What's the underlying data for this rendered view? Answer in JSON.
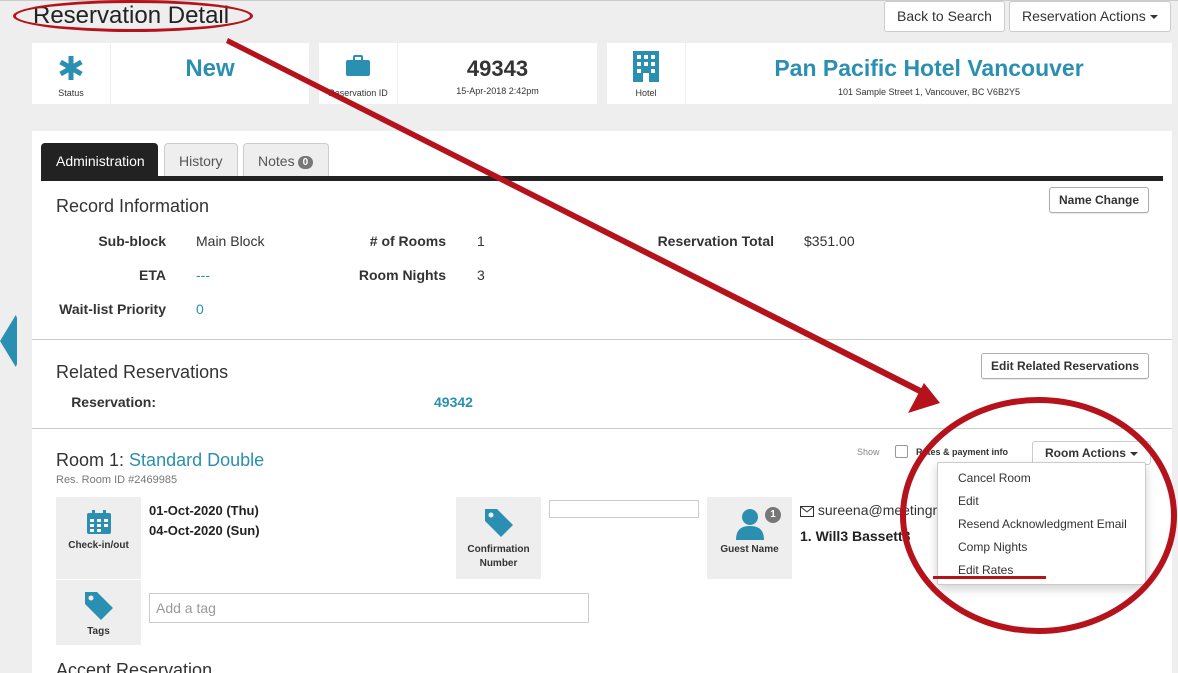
{
  "header": {
    "title": "Reservation Detail",
    "back_label": "Back to Search",
    "actions_label": "Reservation Actions"
  },
  "status_card": {
    "value": "New",
    "label": "Status",
    "icon": "asterisk-icon"
  },
  "reservation_card": {
    "value": "49343",
    "sub": "15-Apr-2018 2:42pm",
    "label": "Reservation ID",
    "icon": "briefcase-icon"
  },
  "hotel_card": {
    "name": "Pan Pacific Hotel Vancouver",
    "address": "101 Sample Street 1, Vancouver, BC V6B2Y5",
    "label": "Hotel",
    "icon": "building-icon"
  },
  "tabs": [
    {
      "label": "Administration",
      "active": true
    },
    {
      "label": "History",
      "active": false
    },
    {
      "label": "Notes",
      "badge": "0",
      "active": false
    }
  ],
  "record": {
    "title": "Record Information",
    "name_change_label": "Name Change",
    "subblock_label": "Sub-block",
    "subblock_value": "Main Block",
    "eta_label": "ETA",
    "eta_value": "---",
    "waitlist_label": "Wait-list Priority",
    "waitlist_value": "0",
    "rooms_label": "# of Rooms",
    "rooms_value": "1",
    "nights_label": "Room Nights",
    "nights_value": "3",
    "total_label": "Reservation Total",
    "total_value": "$351.00"
  },
  "related": {
    "title": "Related Reservations",
    "edit_label": "Edit Related Reservations",
    "reservation_label": "Reservation:",
    "reservation_value": "49342"
  },
  "room": {
    "title_prefix": "Room 1:",
    "room_type": "Standard Double",
    "room_id": "Res. Room ID #2469985",
    "show_label": "Show",
    "rates_label": "Rates & payment info",
    "actions_label": "Room Actions",
    "checkin_label": "Check-in/out",
    "checkin": "01-Oct-2020 (Thu)",
    "checkout": "04-Oct-2020 (Sun)",
    "confirmation_label_1": "Confirmation",
    "confirmation_label_2": "Number",
    "guest_label": "Guest Name",
    "guest_count": "1",
    "guest_email": "sureena@meetingm",
    "guest_name": "1. Will3 Bassett3",
    "tags_label": "Tags",
    "tag_placeholder": "Add a tag"
  },
  "room_actions_menu": [
    "Cancel Room",
    "Edit",
    "Resend Acknowledgment Email",
    "Comp Nights",
    "Edit Rates"
  ],
  "accept_title": "Accept Reservation",
  "colors": {
    "accent": "#2a8fb0",
    "annotation": "#b5121b"
  }
}
